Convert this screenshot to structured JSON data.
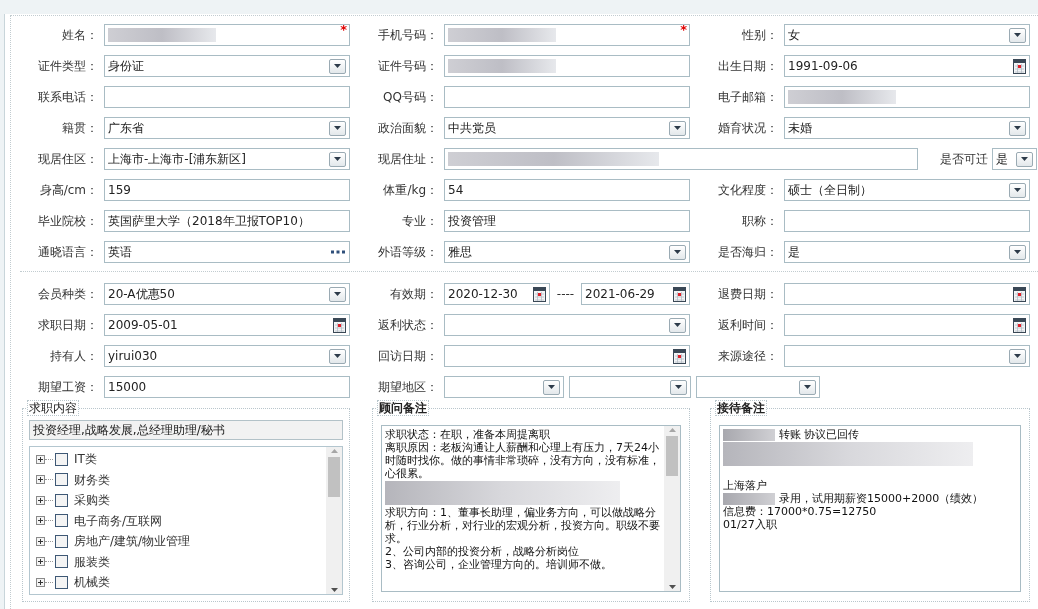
{
  "profile": {
    "rows": [
      [
        {
          "label": "姓名：",
          "kind": "text",
          "redacted": true,
          "marker": "*"
        },
        {
          "label": "手机号码：",
          "kind": "text",
          "redacted": true,
          "marker": "*"
        },
        {
          "label": "性别：",
          "kind": "select",
          "value": "女",
          "redacted": false
        }
      ],
      [
        {
          "label": "证件类型：",
          "kind": "select",
          "value": "身份证",
          "redacted": false
        },
        {
          "label": "证件号码：",
          "kind": "text",
          "redacted": true
        },
        {
          "label": "出生日期：",
          "kind": "date",
          "value": "1991-09-06",
          "redacted": false
        }
      ],
      [
        {
          "label": "联系电话：",
          "kind": "text",
          "redacted": false
        },
        {
          "label": "QQ号码：",
          "kind": "text",
          "redacted": false
        },
        {
          "label": "电子邮箱：",
          "kind": "text",
          "redacted": true
        }
      ],
      [
        {
          "label": "籍贯：",
          "kind": "select",
          "value": "广东省",
          "redacted": false
        },
        {
          "label": "政治面貌：",
          "kind": "select",
          "value": "中共党员",
          "redacted": false
        },
        {
          "label": "婚育状况：",
          "kind": "select",
          "value": "未婚",
          "redacted": false
        }
      ],
      [
        {
          "label": "现居住区：",
          "kind": "select",
          "value": "上海市-上海市-[浦东新区]",
          "redacted": false
        },
        {
          "label": "现居住址：",
          "kind": "wide_text",
          "redacted": true
        },
        {
          "label": "是否可迁",
          "kind": "inline_select",
          "value": "是",
          "redacted": false
        }
      ],
      [
        {
          "label": "身高/cm：",
          "kind": "text",
          "value": "159",
          "redacted": false
        },
        {
          "label": "体重/kg：",
          "kind": "text",
          "value": "54",
          "redacted": false
        },
        {
          "label": "文化程度：",
          "kind": "select",
          "value": "硕士（全日制）",
          "redacted": false
        }
      ],
      [
        {
          "label": "毕业院校：",
          "kind": "text",
          "value": "英国萨里大学（2018年卫报TOP10）",
          "redacted": false
        },
        {
          "label": "专业：",
          "kind": "text",
          "value": "投资管理",
          "redacted": false
        },
        {
          "label": "职称：",
          "kind": "text",
          "redacted": false
        }
      ],
      [
        {
          "label": "通晓语言：",
          "kind": "lookup",
          "value": "英语",
          "redacted": false
        },
        {
          "label": "外语等级：",
          "kind": "select",
          "value": "雅思",
          "redacted": false
        },
        {
          "label": "是否海归：",
          "kind": "select",
          "value": "是",
          "redacted": false
        }
      ]
    ]
  },
  "membership": {
    "rows": [
      [
        {
          "label": "会员种类：",
          "kind": "select",
          "value": "20-A优惠50",
          "redacted": false
        },
        {
          "label": "有效期：",
          "kind": "date_range",
          "from": "2020-12-30",
          "separator": "----",
          "to": "2021-06-29",
          "redacted": false
        },
        {
          "label": "退费日期：",
          "kind": "date",
          "redacted": false
        }
      ],
      [
        {
          "label": "求职日期：",
          "kind": "date",
          "value": "2009-05-01",
          "redacted": false
        },
        {
          "label": "返利状态：",
          "kind": "select",
          "redacted": false
        },
        {
          "label": "返利时间：",
          "kind": "date",
          "redacted": false
        }
      ],
      [
        {
          "label": "持有人：",
          "kind": "select",
          "value": "yirui030",
          "redacted": false
        },
        {
          "label": "回访日期：",
          "kind": "date",
          "redacted": false
        },
        {
          "label": "来源途径：",
          "kind": "select",
          "redacted": false
        }
      ],
      [
        {
          "label": "期望工资：",
          "kind": "text",
          "value": "15000",
          "redacted": false
        },
        {
          "label": "期望地区：",
          "kind": "multi_select",
          "boxes": [
            {
              "kind": "select"
            },
            {
              "kind": "select"
            },
            {
              "kind": "select"
            }
          ],
          "redacted": false
        }
      ]
    ]
  },
  "panels": [
    {
      "kind": "tree",
      "legend": "求职内容",
      "summary": "投资经理,战略发展,总经理助理/秘书",
      "items": [
        {
          "label": "IT类",
          "checked": false,
          "expanded": false
        },
        {
          "label": "财务类",
          "checked": false,
          "expanded": false
        },
        {
          "label": "采购类",
          "checked": false,
          "expanded": false
        },
        {
          "label": "电子商务/互联网",
          "checked": false,
          "expanded": false
        },
        {
          "label": "房地产/建筑/物业管理",
          "checked": false,
          "expanded": false
        },
        {
          "label": "服装类",
          "checked": false,
          "expanded": false
        },
        {
          "label": "机械类",
          "checked": false,
          "expanded": false
        }
      ]
    },
    {
      "kind": "notes",
      "legend": "顾问备注",
      "scrollable": true,
      "lines": [
        {
          "kind": "text",
          "text": "求职状态：在职，准备本周提离职"
        },
        {
          "kind": "text",
          "text": "离职原因：老板沟通让人薪酬和心理上有压力，7天24小时随时找你。做的事情非常琐碎，没有方向，没有标准，心很累。"
        },
        {
          "kind": "redacted"
        },
        {
          "kind": "text",
          "text": "求职方向：1、董事长助理，偏业务方向，可以做战略分析，行业分析，对行业的宏观分析，投资方向。职级不要求。"
        },
        {
          "kind": "text",
          "text": "2、公司内部的投资分析，战略分析岗位"
        },
        {
          "kind": "text",
          "text": "3、咨询公司，企业管理方向的。培训师不做。"
        }
      ]
    },
    {
      "kind": "notes",
      "legend": "接待备注",
      "scrollable": false,
      "lines": [
        {
          "kind": "redacted_prefix",
          "text": "转账 协议已回传"
        },
        {
          "kind": "redacted"
        },
        {
          "kind": "gap"
        },
        {
          "kind": "text",
          "text": "上海落户"
        },
        {
          "kind": "redacted_prefix",
          "text": "录用，试用期薪资15000+2000（绩效）"
        },
        {
          "kind": "text",
          "text": "信息费：17000*0.75=12750"
        },
        {
          "kind": "text",
          "text": "01/27入职"
        }
      ]
    }
  ]
}
